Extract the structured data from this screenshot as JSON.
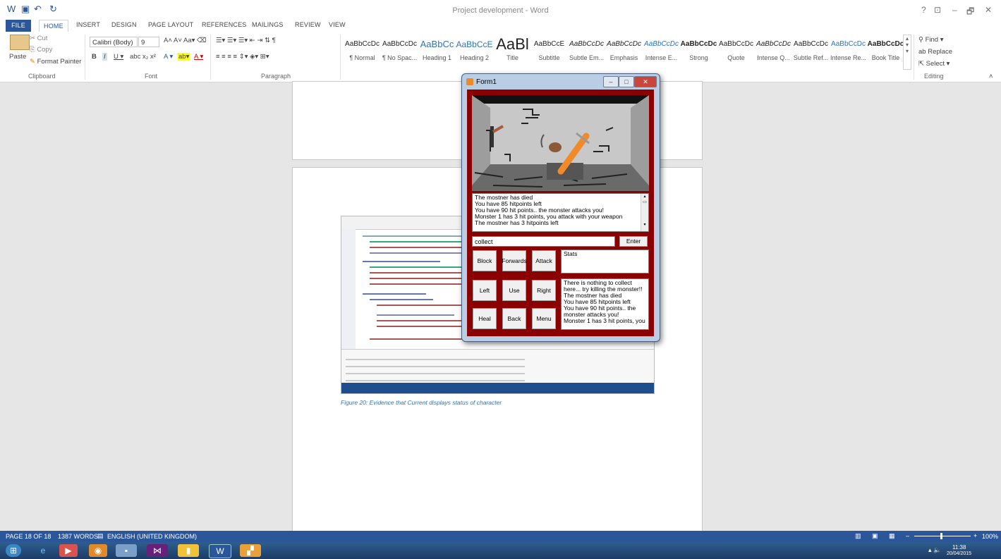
{
  "window": {
    "title": "Project development - Word"
  },
  "title_controls": [
    "?",
    "⊡",
    "–",
    "🗗",
    "✕"
  ],
  "tabs": [
    "FILE",
    "HOME",
    "INSERT",
    "DESIGN",
    "PAGE LAYOUT",
    "REFERENCES",
    "MAILINGS",
    "REVIEW",
    "VIEW"
  ],
  "clipboard": {
    "paste": "Paste",
    "cut": "Cut",
    "copy": "Copy",
    "format_painter": "Format Painter",
    "label": "Clipboard"
  },
  "font": {
    "family": "Calibri (Body)",
    "size": "9",
    "label": "Font"
  },
  "paragraph": {
    "label": "Paragraph"
  },
  "styles": [
    {
      "preview": "AaBbCcDc",
      "name": "¶ Normal"
    },
    {
      "preview": "AaBbCcDc",
      "name": "¶ No Spac..."
    },
    {
      "preview": "AaBbCc",
      "name": "Heading 1"
    },
    {
      "preview": "AaBbCcE",
      "name": "Heading 2"
    },
    {
      "preview": "AaBl",
      "name": "Title"
    },
    {
      "preview": "AaBbCcE",
      "name": "Subtitle"
    },
    {
      "preview": "AaBbCcDc",
      "name": "Subtle Em..."
    },
    {
      "preview": "AaBbCcDc",
      "name": "Emphasis"
    },
    {
      "preview": "AaBbCcDc",
      "name": "Intense E..."
    },
    {
      "preview": "AaBbCcDc",
      "name": "Strong"
    },
    {
      "preview": "AaBbCcDc",
      "name": "Quote"
    },
    {
      "preview": "AaBbCcDc",
      "name": "Intense Q..."
    },
    {
      "preview": "AaBbCcDc",
      "name": "Subtle Ref..."
    },
    {
      "preview": "AaBbCcDc",
      "name": "Intense Re..."
    },
    {
      "preview": "AaBbCcDc",
      "name": "Book Title"
    }
  ],
  "editing": {
    "find": "Find",
    "replace": "Replace",
    "select": "Select",
    "label": "Editing"
  },
  "doc": {
    "caption": "Figure 20: Evidence that Current displays status of character"
  },
  "status": {
    "page": "PAGE 18 OF 18",
    "words": "1387 WORDS",
    "lang": "ENGLISH (UNITED KINGDOM)",
    "zoom": "100%"
  },
  "clock": {
    "time": "11:38",
    "date": "20/04/2015"
  },
  "form": {
    "title": "Form1",
    "log_lines": [
      "The mostner has died",
      "You have 85 hitpoints left",
      "You have 90 hit points.. the monster attacks you!",
      "Monster 1 has 3 hit points, you attack with your weapon",
      "The mostner has 3 hitpoints left"
    ],
    "command_value": "collect",
    "enter": "Enter",
    "stats_label": "Stats",
    "buttons": {
      "block": "Block",
      "forwards": "Forwards",
      "attack": "Attack",
      "left": "Left",
      "use": "Use",
      "right": "Right",
      "heal": "Heal",
      "back": "Back",
      "menu": "Menu"
    },
    "output_lines": [
      "There is nothing to collect here... try killing the monster!!",
      "The mostner has died",
      "You have 85 hitpoints left",
      "You have 90 hit points.. the monster attacks you!",
      "Monster 1 has 3 hit points, you"
    ]
  }
}
